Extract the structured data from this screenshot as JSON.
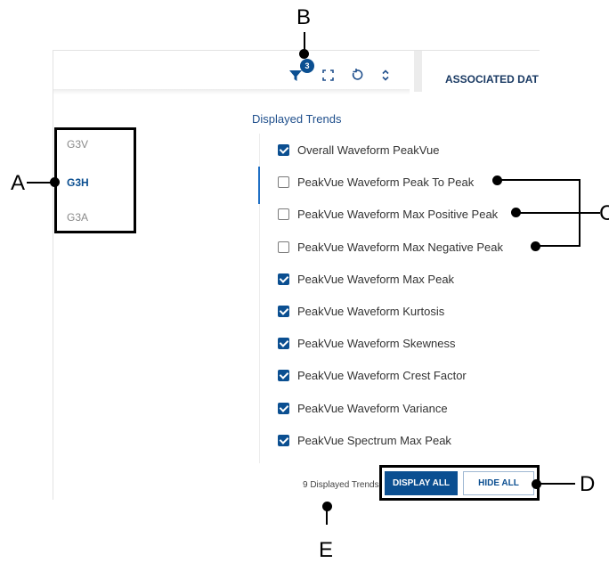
{
  "toolbar": {
    "filter_badge": "3",
    "filter_icon": "funnel-icon",
    "expand_icon": "expand-icon",
    "reset_icon": "rotate-ccw-icon",
    "sort_icon": "chevron-up-down-icon",
    "associated_tab": "ASSOCIATED DAT"
  },
  "sidebar": {
    "items": [
      {
        "label": "G3V",
        "active": false
      },
      {
        "label": "G3H",
        "active": true
      },
      {
        "label": "G3A",
        "active": false
      }
    ]
  },
  "panel": {
    "title": "Displayed Trends",
    "trends": [
      {
        "label": "Overall Waveform PeakVue",
        "checked": true
      },
      {
        "label": "PeakVue Waveform Peak To Peak",
        "checked": false
      },
      {
        "label": "PeakVue Waveform Max Positive Peak",
        "checked": false
      },
      {
        "label": "PeakVue Waveform Max Negative Peak",
        "checked": false
      },
      {
        "label": "PeakVue Waveform Max Peak",
        "checked": true
      },
      {
        "label": "PeakVue Waveform Kurtosis",
        "checked": true
      },
      {
        "label": "PeakVue Waveform Skewness",
        "checked": true
      },
      {
        "label": "PeakVue Waveform Crest Factor",
        "checked": true
      },
      {
        "label": "PeakVue Waveform Variance",
        "checked": true
      },
      {
        "label": "PeakVue Spectrum Max Peak",
        "checked": true
      }
    ]
  },
  "footer": {
    "count_text": "9 Displayed Trends",
    "display_all": "DISPLAY ALL",
    "hide_all": "HIDE ALL"
  },
  "callouts": {
    "a": "A",
    "b": "B",
    "c": "C",
    "d": "D",
    "e": "E"
  },
  "colors": {
    "accent": "#0b4f91",
    "checkbox_border": "#7a7a7a",
    "text": "#333333"
  }
}
